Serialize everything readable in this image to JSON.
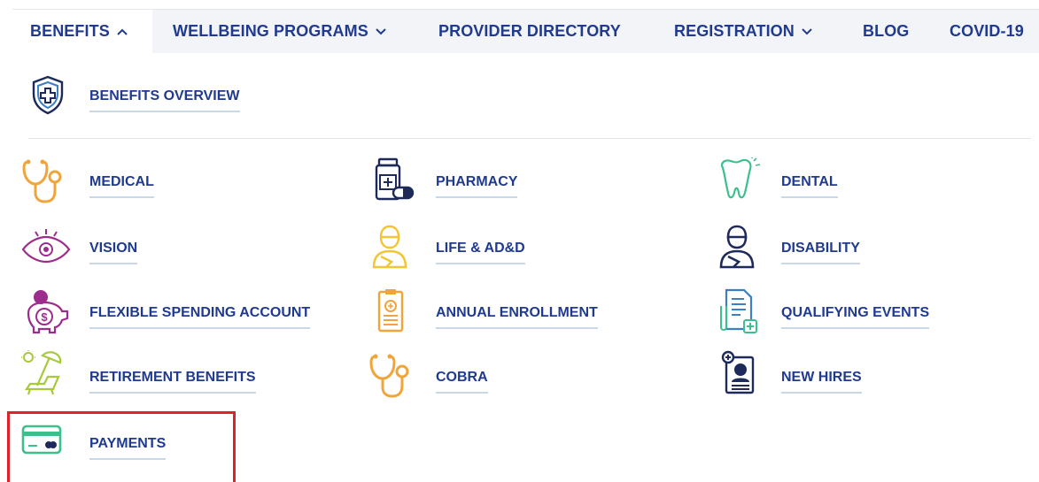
{
  "nav": {
    "items": [
      {
        "label": "BENEFITS",
        "chevron": "up"
      },
      {
        "label": "WELLBEING PROGRAMS",
        "chevron": "down"
      },
      {
        "label": "PROVIDER DIRECTORY",
        "chevron": ""
      },
      {
        "label": "REGISTRATION",
        "chevron": "down"
      },
      {
        "label": "BLOG",
        "chevron": ""
      },
      {
        "label": "COVID-19",
        "chevron": ""
      }
    ]
  },
  "overview": {
    "label": "BENEFITS OVERVIEW",
    "icon": "shield-cross-icon"
  },
  "links": [
    {
      "label": "MEDICAL",
      "icon": "stethoscope-icon"
    },
    {
      "label": "PHARMACY",
      "icon": "pill-bottle-icon"
    },
    {
      "label": "DENTAL",
      "icon": "tooth-icon"
    },
    {
      "label": "VISION",
      "icon": "eye-icon"
    },
    {
      "label": "LIFE & AD&D",
      "icon": "injured-person-icon"
    },
    {
      "label": "DISABILITY",
      "icon": "person-arm-sling-icon"
    },
    {
      "label": "FLEXIBLE SPENDING ACCOUNT",
      "icon": "piggy-bank-icon"
    },
    {
      "label": "ANNUAL ENROLLMENT",
      "icon": "clipboard-icon"
    },
    {
      "label": "QUALIFYING EVENTS",
      "icon": "document-plus-icon"
    },
    {
      "label": "RETIREMENT BENEFITS",
      "icon": "beach-chair-icon"
    },
    {
      "label": "COBRA",
      "icon": "stethoscope-icon"
    },
    {
      "label": "NEW HIRES",
      "icon": "new-hire-profile-icon"
    },
    {
      "label": "PAYMENTS",
      "icon": "credit-card-icon"
    }
  ],
  "colors": {
    "link": "#1f3a8f",
    "underline": "#c9d8e7",
    "highlight": "#e0202a",
    "nav_bg": "#f3f4f7",
    "orange": "#f0a53a",
    "green": "#3bbf8c",
    "purple": "#9c2d8d",
    "lime": "#a7c93a",
    "yellow": "#f3c533",
    "navy": "#1d2a5a"
  }
}
